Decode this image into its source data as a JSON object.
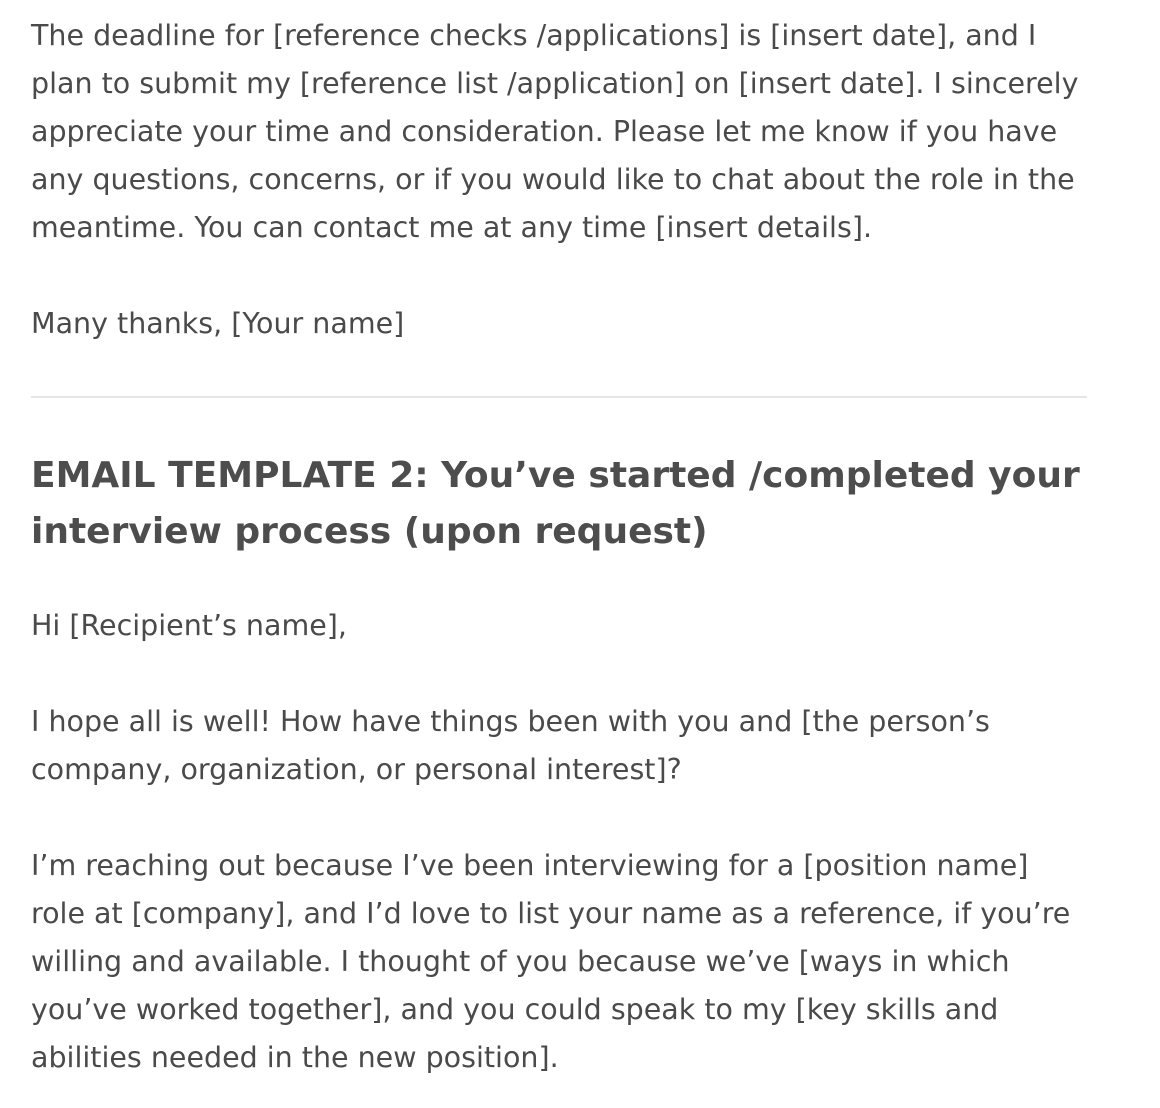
{
  "section_1": {
    "paragraph_1": "The deadline for [reference checks /applications] is [insert date], and I plan to submit my [reference list /application] on [insert date]. I sincerely appreciate your time and consideration. Please let me know if you have any questions, concerns, or if you would like to chat about the role in the meantime. You can contact me at any time [insert details].",
    "signoff": "Many thanks, [Your name]"
  },
  "section_2": {
    "heading": "EMAIL TEMPLATE 2: You’ve started /completed your interview process (upon request)",
    "greeting": "Hi [Recipient’s name],",
    "paragraph_1": "I hope all is well! How have things been with you and [the person’s company, organization, or personal interest]?",
    "paragraph_2": "I’m reaching out because I’ve been interviewing for a [position name] role at [company], and I’d love to list your name as a reference, if you’re willing and available. I thought of you because we’ve [ways in which you’ve worked together], and you could speak to my [key skills and abilities needed in the new position]."
  }
}
